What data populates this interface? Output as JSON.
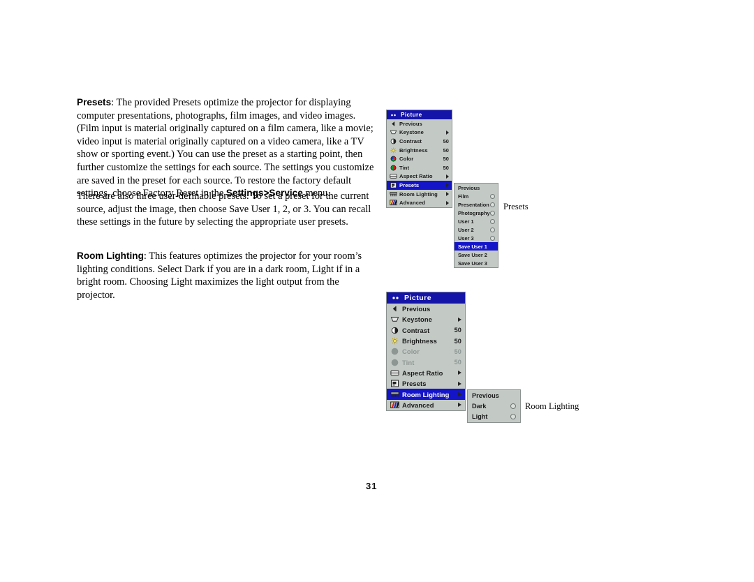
{
  "page": {
    "folio": "31"
  },
  "body_text": {
    "para_presets_lead": "Presets",
    "para_presets": ": The provided Presets optimize the projector for displaying computer presentations, photographs, film images, and video images. (Film input is material originally captured on a film camera, like a movie; video input is material originally captured on a video camera, like a TV show or sporting event.) You can use the preset as a starting point, then further customize the settings for each source. The settings you customize are saved in the preset for each source. To restore the factory default settings, choose Factory Reset in the ",
    "para_presets_bold2": "Settings>Service",
    "para_presets_tail": " menu.",
    "para_userdef": "There are also three user-definable presets. To set a preset for the current source, adjust the image, then choose Save User 1, 2, or 3. You can recall these settings in the future by selecting the appropriate user presets.",
    "para_room_lead": "Room Lighting",
    "para_room": ": This features optimizes the projector for your room’s lighting conditions. Select Dark if you are in a dark room, Light if in a bright room. Choosing Light maximizes the light output from the projector."
  },
  "captions": {
    "presets": "Presets",
    "room_lighting": "Room Lighting"
  },
  "colors": {
    "menu_bg": "#c3cac6",
    "title_bar": "#1414a8",
    "highlight": "#1414c8",
    "highlight_text": "#ffffff",
    "disabled_text": "#8e9693"
  },
  "menu_top": {
    "title": "Picture",
    "title_icon": "dots-icon",
    "rows": [
      {
        "label": "Previous",
        "icon": "back-arrow-icon",
        "value": "",
        "arrow": false,
        "selected": false,
        "disabled": false
      },
      {
        "label": "Keystone",
        "icon": "keystone-icon",
        "value": "",
        "arrow": true,
        "selected": false,
        "disabled": false
      },
      {
        "label": "Contrast",
        "icon": "contrast-icon",
        "value": "50",
        "arrow": false,
        "selected": false,
        "disabled": false
      },
      {
        "label": "Brightness",
        "icon": "brightness-icon",
        "value": "50",
        "arrow": false,
        "selected": false,
        "disabled": false
      },
      {
        "label": "Color",
        "icon": "color-icon",
        "value": "50",
        "arrow": false,
        "selected": false,
        "disabled": false
      },
      {
        "label": "Tint",
        "icon": "tint-icon",
        "value": "50",
        "arrow": false,
        "selected": false,
        "disabled": false
      },
      {
        "label": "Aspect Ratio",
        "icon": "aspect-ratio-icon",
        "value": "",
        "arrow": true,
        "selected": false,
        "disabled": false
      },
      {
        "label": "Presets",
        "icon": "presets-icon",
        "value": "",
        "arrow": true,
        "selected": true,
        "disabled": false
      },
      {
        "label": "Room Lighting",
        "icon": "room-lighting-icon",
        "value": "",
        "arrow": true,
        "selected": false,
        "disabled": false
      },
      {
        "label": "Advanced",
        "icon": "advanced-icon",
        "value": "",
        "arrow": true,
        "selected": false,
        "disabled": false
      }
    ]
  },
  "submenu_presets": {
    "rows": [
      {
        "label": "Previous",
        "radio": false,
        "selected": false
      },
      {
        "label": "Film",
        "radio": true,
        "selected": false
      },
      {
        "label": "Presentation",
        "radio": true,
        "selected": false
      },
      {
        "label": "Photography",
        "radio": true,
        "selected": false
      },
      {
        "label": "User 1",
        "radio": true,
        "selected": false
      },
      {
        "label": "User 2",
        "radio": true,
        "selected": false
      },
      {
        "label": "User 3",
        "radio": true,
        "selected": false
      },
      {
        "label": "Save User 1",
        "radio": false,
        "selected": true
      },
      {
        "label": "Save User 2",
        "radio": false,
        "selected": false
      },
      {
        "label": "Save User 3",
        "radio": false,
        "selected": false
      }
    ]
  },
  "menu_bottom": {
    "title": "Picture",
    "title_icon": "dots-icon",
    "rows": [
      {
        "label": "Previous",
        "icon": "back-arrow-icon",
        "value": "",
        "arrow": false,
        "selected": false,
        "disabled": false
      },
      {
        "label": "Keystone",
        "icon": "keystone-icon",
        "value": "",
        "arrow": true,
        "selected": false,
        "disabled": false
      },
      {
        "label": "Contrast",
        "icon": "contrast-icon",
        "value": "50",
        "arrow": false,
        "selected": false,
        "disabled": false
      },
      {
        "label": "Brightness",
        "icon": "brightness-icon",
        "value": "50",
        "arrow": false,
        "selected": false,
        "disabled": false
      },
      {
        "label": "Color",
        "icon": "color-icon",
        "value": "50",
        "arrow": false,
        "selected": false,
        "disabled": true
      },
      {
        "label": "Tint",
        "icon": "tint-icon",
        "value": "50",
        "arrow": false,
        "selected": false,
        "disabled": true
      },
      {
        "label": "Aspect Ratio",
        "icon": "aspect-ratio-icon",
        "value": "",
        "arrow": true,
        "selected": false,
        "disabled": false
      },
      {
        "label": "Presets",
        "icon": "presets-icon",
        "value": "",
        "arrow": true,
        "selected": false,
        "disabled": false
      },
      {
        "label": "Room Lighting",
        "icon": "room-lighting-icon",
        "value": "",
        "arrow": true,
        "selected": true,
        "disabled": false
      },
      {
        "label": "Advanced",
        "icon": "advanced-icon",
        "value": "",
        "arrow": true,
        "selected": false,
        "disabled": false
      }
    ]
  },
  "submenu_roomlight": {
    "rows": [
      {
        "label": "Previous",
        "radio": false,
        "selected": false
      },
      {
        "label": "Dark",
        "radio": true,
        "selected": false
      },
      {
        "label": "Light",
        "radio": true,
        "selected": false
      }
    ]
  }
}
